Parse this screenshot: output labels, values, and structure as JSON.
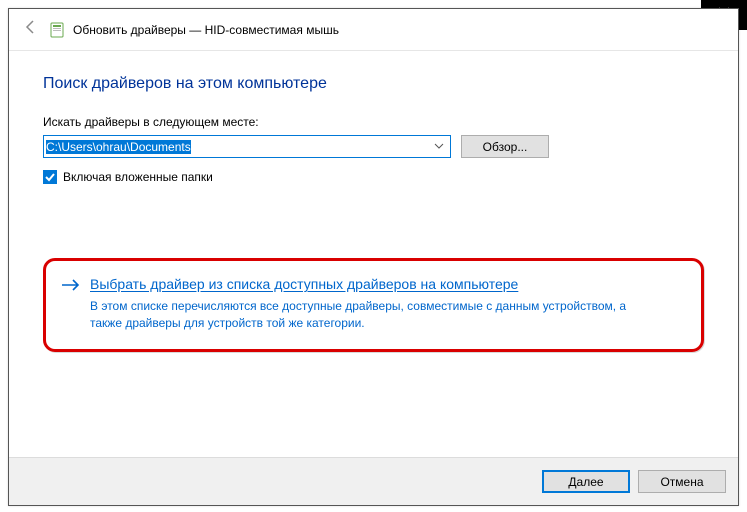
{
  "window": {
    "title": "Обновить драйверы — HID-совместимая мышь"
  },
  "heading": "Поиск драйверов на этом компьютере",
  "search_label": "Искать драйверы в следующем месте:",
  "path_value": "C:\\Users\\ohrau\\Documents",
  "browse_label": "Обзор...",
  "include_sub_label": "Включая вложенные папки",
  "pick": {
    "title": "Выбрать драйвер из списка доступных драйверов на компьютере",
    "desc": "В этом списке перечисляются все доступные драйверы, совместимые с данным устройством, а также драйверы для устройств той же категории."
  },
  "footer": {
    "next": "Далее",
    "cancel": "Отмена"
  }
}
